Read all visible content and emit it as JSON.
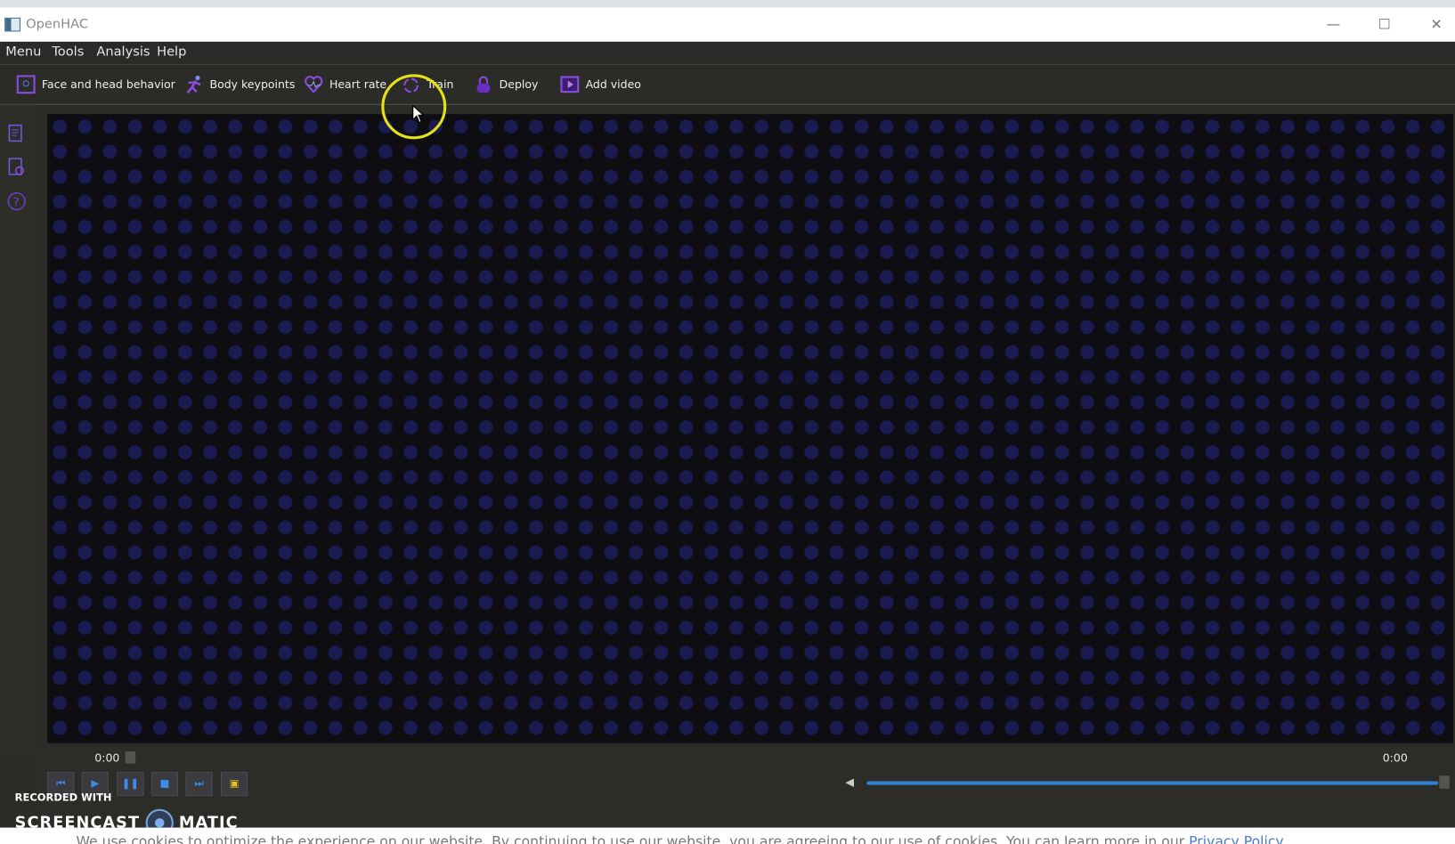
{
  "window": {
    "title": "OpenHAC"
  },
  "menu": [
    "Menu",
    "Tools",
    "Analysis",
    "Help"
  ],
  "toolbar": [
    {
      "label": "Face and head behavior",
      "icon": "face-frame-icon"
    },
    {
      "label": "Body keypoints",
      "icon": "running-body-icon"
    },
    {
      "label": "Heart rate",
      "icon": "heart-pulse-icon"
    },
    {
      "label": "Train",
      "icon": "train-cycle-icon"
    },
    {
      "label": "Deploy",
      "icon": "deploy-lock-icon"
    },
    {
      "label": "Add video",
      "icon": "video-add-icon"
    }
  ],
  "player": {
    "current_time": "0:00",
    "total_time": "0:00",
    "volume_percent": 100
  },
  "watermark": {
    "line1": "RECORDED WITH",
    "left": "SCREENCAST",
    "right": "MATIC"
  },
  "cookie": {
    "text": "We use cookies to optimize the experience on our website. By continuing to use our website, you are agreeing to our use of cookies. You can learn more in our ",
    "link": "Privacy Policy"
  },
  "colors": {
    "accent": "#2f7fd6",
    "icon": "#8a4ce0",
    "cursor_highlight": "#e6e01a"
  }
}
